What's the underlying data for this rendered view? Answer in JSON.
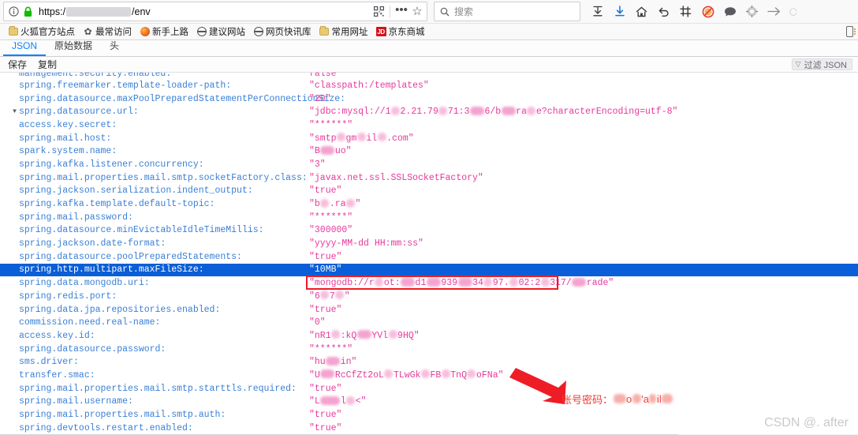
{
  "browser": {
    "urlbar": {
      "info_icon": "info-icon",
      "lock_icon": "lock-icon",
      "url_prefix": "https:/",
      "url_suffix": "/env",
      "qr_icon": "qr-code-icon",
      "more_icon": "ellipsis-icon",
      "bookmark_star_icon": "star-icon"
    },
    "search": {
      "icon": "search-icon",
      "placeholder": "搜索"
    },
    "toolbar_icons": [
      {
        "name": "pocket-save-icon",
        "glyph": "⛨"
      },
      {
        "name": "downloads-icon",
        "glyph": "↓"
      },
      {
        "name": "home-icon",
        "glyph": "⌂"
      },
      {
        "name": "undo-icon",
        "glyph": "↶"
      },
      {
        "name": "screenshot-icon",
        "glyph": "⌗"
      },
      {
        "name": "adblock-icon",
        "glyph": "⊘"
      },
      {
        "name": "chat-icon",
        "glyph": "💬"
      },
      {
        "name": "settings-gear-icon",
        "glyph": "⚙"
      },
      {
        "name": "forward-arrow-icon",
        "glyph": "→"
      },
      {
        "name": "profile-icon",
        "glyph": "("
      }
    ],
    "bookmarks": [
      {
        "label": "火狐官方站点",
        "icon": "folder-icon"
      },
      {
        "label": "最常访问",
        "icon": "gear-icon"
      },
      {
        "label": "新手上路",
        "icon": "firefox-icon"
      },
      {
        "label": "建议网站",
        "icon": "globe-icon"
      },
      {
        "label": "网页快讯库",
        "icon": "globe-icon"
      },
      {
        "label": "常用网址",
        "icon": "folder-icon"
      },
      {
        "label": "京东商城",
        "icon": "jd-icon",
        "badge": "JD"
      }
    ],
    "bookmarks_overflow_icon": "mobile-bookmarks-icon"
  },
  "json_viewer": {
    "tabs": [
      {
        "label": "JSON",
        "active": true
      },
      {
        "label": "原始数据",
        "active": false
      },
      {
        "label": "头",
        "active": false
      }
    ],
    "actions": [
      {
        "label": "保存"
      },
      {
        "label": "复制"
      }
    ],
    "filter": {
      "icon": "funnel-icon",
      "label": "过滤 JSON"
    },
    "rows": [
      {
        "key": "management.security.enabled:",
        "value": "false",
        "clipped": true
      },
      {
        "key": "spring.freemarker.template-loader-path:",
        "value": "\"classpath:/templates\""
      },
      {
        "key": "spring.datasource.maxPoolPreparedStatementPerConnectionSize:",
        "value": "\"20\""
      },
      {
        "key": "spring.datasource.url:",
        "value": "\"jdbc:mysql://1▒2.21.79▒71:3▒▒6/b▒▒ra▒e?characterEncoding=utf-8\"",
        "twisty": "▼",
        "redacted": true
      },
      {
        "key": "access.key.secret:",
        "value": "\"******\""
      },
      {
        "key": "spring.mail.host:",
        "value": "\"smtp▒gm▒il▒.com\"",
        "redacted": true
      },
      {
        "key": "spark.system.name:",
        "value": "\"B▒▒uo\"",
        "redacted": true
      },
      {
        "key": "spring.kafka.listener.concurrency:",
        "value": "\"3\""
      },
      {
        "key": "spring.mail.properties.mail.smtp.socketFactory.class:",
        "value": "\"javax.net.ssl.SSLSocketFactory\""
      },
      {
        "key": "spring.jackson.serialization.indent_output:",
        "value": "\"true\""
      },
      {
        "key": "spring.kafka.template.default-topic:",
        "value": "\"b▒.ra▒\"",
        "redacted": true
      },
      {
        "key": "spring.mail.password:",
        "value": "\"******\""
      },
      {
        "key": "spring.datasource.minEvictableIdleTimeMillis:",
        "value": "\"300000\""
      },
      {
        "key": "spring.jackson.date-format:",
        "value": "\"yyyy-MM-dd HH:mm:ss\""
      },
      {
        "key": "spring.datasource.poolPreparedStatements:",
        "value": "\"true\""
      },
      {
        "key": "spring.http.multipart.maxFileSize:",
        "value": "\"10MB\"",
        "selected": true
      },
      {
        "key": "spring.data.mongodb.uri:",
        "value": "\"mongodb://r▒ot:▒▒d1▒▒939▒▒34▒97.▒02:2▒317/▒▒rade\"",
        "boxed": true,
        "redacted": true
      },
      {
        "key": "spring.redis.port:",
        "value": "\"6▒7▒\"",
        "redacted": true
      },
      {
        "key": "spring.data.jpa.repositories.enabled:",
        "value": "\"true\""
      },
      {
        "key": "commission.need.real-name:",
        "value": "\"0\""
      },
      {
        "key": "access.key.id:",
        "value": "\"nR1▒:kQ▒▒YVl▒9HQ\"",
        "redacted": true
      },
      {
        "key": "spring.datasource.password:",
        "value": "\"******\""
      },
      {
        "key": "sms.driver:",
        "value": "\"hu▒▒in\"",
        "redacted": true
      },
      {
        "key": "transfer.smac:",
        "value": "\"U▒▒RcCfZt2oL▒TLwGk▒FB▒TnQ▒oFNa\"",
        "redacted": true
      },
      {
        "key": "spring.mail.properties.mail.smtp.starttls.required:",
        "value": "\"true\""
      },
      {
        "key": "spring.mail.username:",
        "value": "\"L▒▒▒l▒<\"",
        "redacted": true
      },
      {
        "key": "spring.mail.properties.mail.smtp.auth:",
        "value": "\"true\""
      },
      {
        "key": "spring.devtools.restart.enabled:",
        "value": "\"true\""
      }
    ]
  },
  "annotations": {
    "box_target_row": "spring.data.mongodb.uri",
    "arrow_color": "#ee1c25",
    "label_prefix": "账号密码：",
    "label_redacted_text": "▒▒o▒'a▒il▒▒",
    "box_color": "#ee1c25"
  },
  "watermark": {
    "text": "CSDN @. after"
  }
}
